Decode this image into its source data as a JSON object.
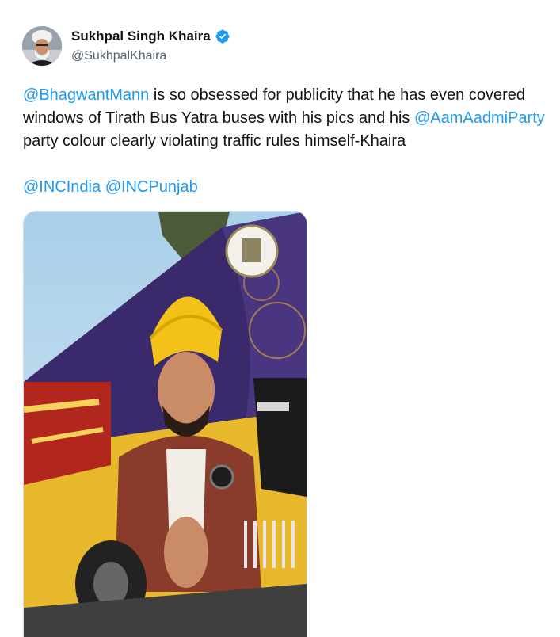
{
  "author": {
    "display_name": "Sukhpal Singh Khaira",
    "handle": "@SukhpalKhaira",
    "verified": true,
    "avatar_icon": "profile-photo"
  },
  "tweet": {
    "line1": {
      "mention": "@BhagwantMann",
      "text": " is so obsessed for publicity that he has even covered"
    },
    "line2": {
      "text": "windows of Tirath Bus Yatra buses with his pics and his ",
      "mention": "@AamAadmiParty"
    },
    "line3": {
      "text": "party colour clearly violating traffic rules himself-Khaira"
    },
    "tags": [
      "@INCIndia",
      "@INCPunjab"
    ]
  },
  "media": {
    "description_icon": "photo-bus-wrap"
  },
  "colors": {
    "link": "#1d9bf0",
    "verified": "#1d9bf0",
    "handle": "#536471",
    "bus_yellow": "#e8b92c",
    "bus_purple": "#3b2a6b",
    "turban": "#f2c21a"
  }
}
